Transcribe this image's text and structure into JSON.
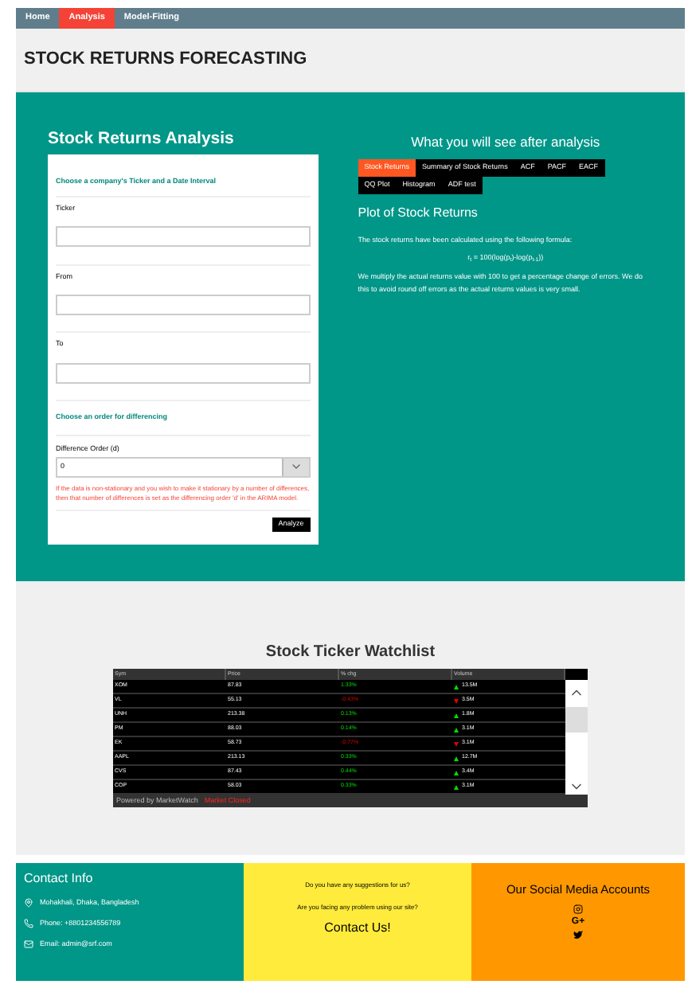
{
  "nav": [
    {
      "label": "Home",
      "selected": false
    },
    {
      "label": "Analysis",
      "selected": true
    },
    {
      "label": "Model-Fitting",
      "selected": false
    }
  ],
  "page_title": "STOCK RETURNS FORECASTING",
  "form": {
    "title": "Stock Returns Analysis",
    "section_1": "Choose a company's Ticker and a Date Interval",
    "fields": [
      {
        "label": "Ticker"
      },
      {
        "label": "From"
      },
      {
        "label": "To"
      }
    ],
    "section_2": "Choose an order for differencing",
    "select": {
      "label": "Difference Order (d)",
      "value": "0"
    },
    "note": "If the data is non-stationary and you wish to make it stationary by a number of differences, then that number of differences is set as the differencing order 'd' in the ARIMA model.",
    "button": "Analyze"
  },
  "preview": {
    "title": "What you will see after analysis",
    "tabs": [
      {
        "label": "Stock Returns",
        "selected": true
      },
      {
        "label": "Summary of Stock Returns",
        "selected": false
      },
      {
        "label": "ACF",
        "selected": false
      },
      {
        "label": "PACF",
        "selected": false
      },
      {
        "label": "EACF",
        "selected": false
      },
      {
        "label": "QQ Plot",
        "selected": false
      },
      {
        "label": "Histogram",
        "selected": false
      },
      {
        "label": "ADF test",
        "selected": false
      }
    ],
    "heading": "Plot of Stock Returns",
    "text_1": "The stock returns have been calculated using the following formula:",
    "formula": "r$_{t}$ = 100(log(p$_{t}$)-log(p$_{t-1}$))",
    "text_2": "We multiply the actual returns value with 100 to get a percentage change of errors. We do this to avoid round off errors as the actual returns values is very small."
  },
  "watchlist": {
    "title": "Stock Ticker Watchlist",
    "columns": [
      "Sym",
      "Price",
      "% chg",
      "Volume"
    ],
    "rows": [
      {
        "sym": "XOM",
        "price": "87.83",
        "change": "1.33%",
        "up": true,
        "volume": "13.5M"
      },
      {
        "sym": "VL",
        "price": "55.13",
        "change": "-0.43%",
        "up": false,
        "volume": "3.5M"
      },
      {
        "sym": "UNH",
        "price": "213.38",
        "change": "0.13%",
        "up": true,
        "volume": "1.8M"
      },
      {
        "sym": "PM",
        "price": "88.03",
        "change": "0.14%",
        "up": true,
        "volume": "3.1M"
      },
      {
        "sym": "EK",
        "price": "58.73",
        "change": "-0.77%",
        "up": false,
        "volume": "3.1M"
      },
      {
        "sym": "AAPL",
        "price": "213.13",
        "change": "0.33%",
        "up": true,
        "volume": "12.7M"
      },
      {
        "sym": "CVS",
        "price": "87.43",
        "change": "0.44%",
        "up": true,
        "volume": "3.4M"
      },
      {
        "sym": "COP",
        "price": "58.03",
        "change": "0.33%",
        "up": true,
        "volume": "3.1M"
      }
    ],
    "footer_note": "Powered by MarketWatch",
    "status": "Market Closed"
  },
  "contact": {
    "title": "Contact Info",
    "items": [
      {
        "kind": "address",
        "text": "Mohakhali, Dhaka, Bangladesh"
      },
      {
        "kind": "phone",
        "text": "Phone: +8801234556789"
      },
      {
        "kind": "email",
        "text": "Email: admin@srf.com"
      }
    ]
  },
  "feedback": {
    "line_1": "Do you have any suggestions for us?",
    "line_2": "Are you facing any problem using our site?",
    "link": "Contact Us!"
  },
  "social": {
    "title": "Our Social Media Accounts",
    "items": [
      {
        "kind": "instagram"
      },
      {
        "kind": "google",
        "text": "G+"
      },
      {
        "kind": "twitter"
      }
    ]
  }
}
